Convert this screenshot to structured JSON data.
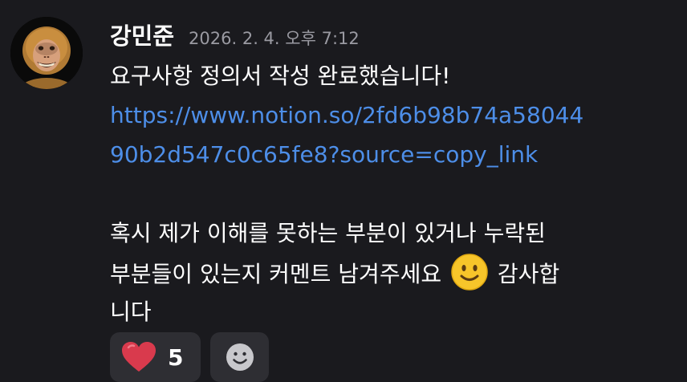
{
  "message": {
    "author": "강민준",
    "timestamp": "2026. 2. 4. 오후 7:12",
    "lines": {
      "l1": "요구사항 정의서 작성 완료했습니다!",
      "link1": "https://www.notion.so/2fd6b98b74a58044",
      "link2": "90b2d547c0c65fe8?source=copy_link",
      "l3": "혹시 제가 이해를 못하는 부분이 있거나 누락된",
      "l4a": "부분들이 있는지 커멘트 남겨주세요",
      "l4b": "감사합",
      "l5": "니다"
    },
    "emoji_inline": "slightly-smiling-face"
  },
  "reactions": {
    "heart": {
      "emoji": "red-heart",
      "count": "5"
    },
    "add": {
      "icon": "add-reaction-smiley-icon"
    }
  },
  "colors": {
    "background": "#1a1a1e",
    "link": "#4d8ee8",
    "chip": "#2e2e33",
    "timestamp": "#9a9aa2"
  }
}
